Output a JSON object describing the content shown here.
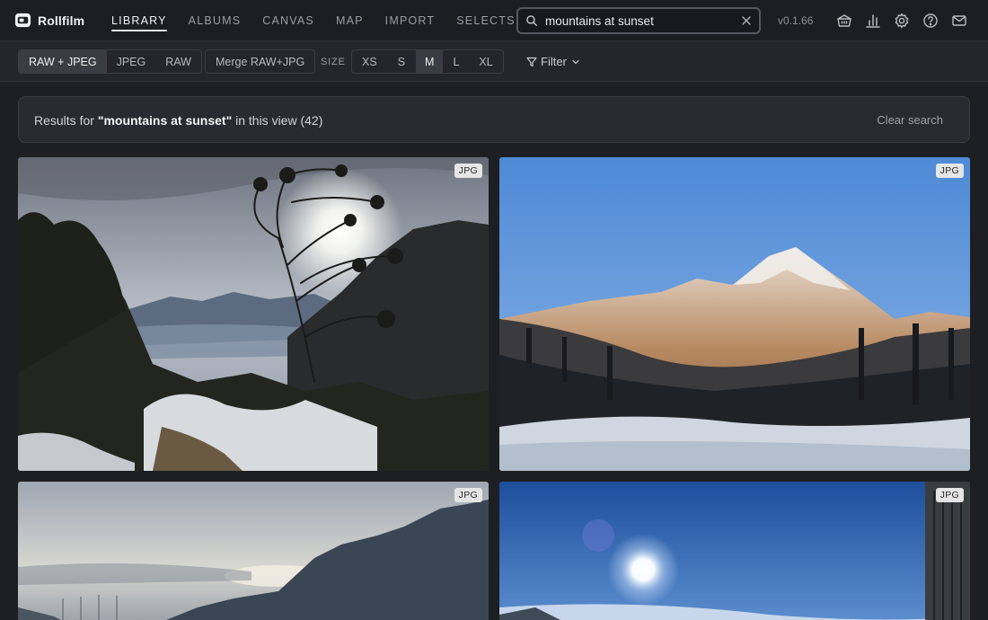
{
  "app": {
    "name": "Rollfilm",
    "version": "v0.1.66"
  },
  "nav": [
    "LIBRARY",
    "ALBUMS",
    "CANVAS",
    "MAP",
    "IMPORT",
    "SELECTS"
  ],
  "search": {
    "value": "mountains at sunset",
    "placeholder": "Search"
  },
  "toolbar": {
    "format_options": [
      "RAW + JPEG",
      "JPEG",
      "RAW"
    ],
    "format_selected": "RAW + JPEG",
    "merge_label": "Merge RAW+JPG",
    "size_label": "SIZE",
    "size_options": [
      "XS",
      "S",
      "M",
      "L",
      "XL"
    ],
    "size_selected": "M",
    "filter_label": "Filter"
  },
  "results": {
    "prefix": "Results for ",
    "query": "\"mountains at sunset\"",
    "suffix": " in this view (42)",
    "clear_label": "Clear search"
  },
  "photos": [
    {
      "badge": "JPG"
    },
    {
      "badge": "JPG"
    },
    {
      "badge": "JPG"
    },
    {
      "badge": "JPG"
    }
  ],
  "icons": [
    "basket-icon",
    "chart-icon",
    "gear-icon",
    "help-icon",
    "mail-icon"
  ]
}
